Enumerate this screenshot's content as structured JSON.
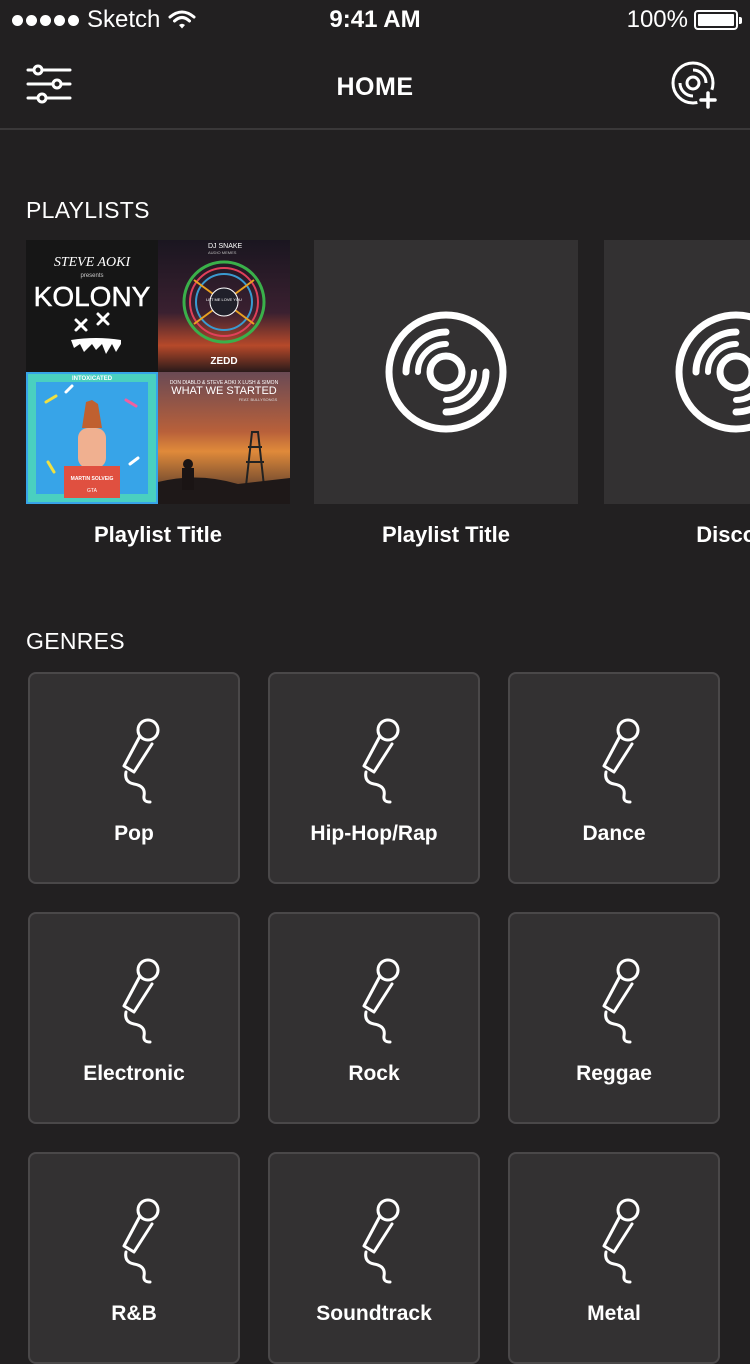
{
  "status_bar": {
    "carrier": "Sketch",
    "time": "9:41 AM",
    "battery": "100%"
  },
  "nav": {
    "title": "HOME",
    "left_icon": "sliders-icon",
    "right_icon": "add-playlist-icon"
  },
  "sections": {
    "playlists": "PLAYLISTS",
    "genres": "GENRES"
  },
  "playlists": [
    {
      "title": "Playlist Title",
      "art": "album-mosaic"
    },
    {
      "title": "Playlist Title",
      "art": "vinyl-icon"
    },
    {
      "title": "Disco/F",
      "art": "vinyl-icon"
    }
  ],
  "album_mosaic": {
    "tile1": {
      "top": "STEVE AOKI",
      "sub": "presents",
      "main": "KOLONY"
    },
    "tile2": {
      "top": "DJ SNAKE",
      "sub": "AUDIO MEMES",
      "badge": "LET ME LOVE YOU",
      "bottom": "ZEDD"
    },
    "tile3": {
      "top": "INTOXICATED",
      "name": "MARTIN SOLVEIG",
      "sub": "GTA"
    },
    "tile4": {
      "top": "DON DIABLO & STEVE AOKI X LUSH & SIMON",
      "main": "WHAT WE STARTED",
      "sub": "FEAT. BULLYSONGS"
    }
  },
  "genres": [
    {
      "label": "Pop"
    },
    {
      "label": "Hip-Hop/Rap"
    },
    {
      "label": "Dance"
    },
    {
      "label": "Electronic"
    },
    {
      "label": "Rock"
    },
    {
      "label": "Reggae"
    },
    {
      "label": "R&B"
    },
    {
      "label": "Soundtrack"
    },
    {
      "label": "Metal"
    }
  ],
  "colors": {
    "background": "#222021",
    "card": "#333132",
    "card_border": "#4a4849",
    "text": "#ffffff"
  }
}
